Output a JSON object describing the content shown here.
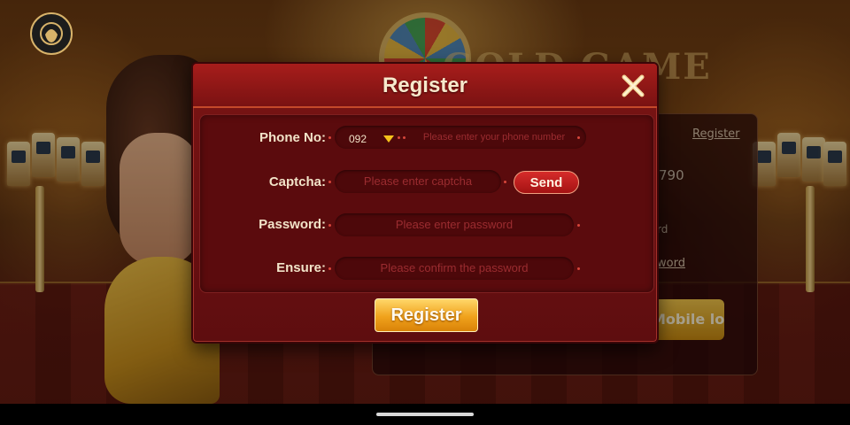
{
  "background": {
    "title": "GOLD GAME",
    "register_link": "Register",
    "fragment_number": "790",
    "fragment_word": "rd",
    "fragment_link": "word",
    "mobile_login_button": "Mobile login"
  },
  "modal": {
    "title": "Register",
    "close_icon": "close-x-icon",
    "fields": {
      "phone": {
        "label": "Phone No:",
        "prefix": "092",
        "placeholder": "Please enter your phone number"
      },
      "captcha": {
        "label": "Captcha:",
        "placeholder": "Please enter captcha",
        "send_label": "Send"
      },
      "password": {
        "label": "Password:",
        "placeholder": "Please enter password"
      },
      "ensure": {
        "label": "Ensure:",
        "placeholder": "Please confirm the password"
      }
    },
    "submit_label": "Register"
  },
  "colors": {
    "modal_bg": "#6a1012",
    "field_bg": "#4d080a",
    "placeholder": "#9b2c30",
    "label": "#f2e3c8",
    "send_button": "#c01e1f",
    "register_button": "#f0a21c",
    "dropdown_arrow": "#f5c21b"
  }
}
